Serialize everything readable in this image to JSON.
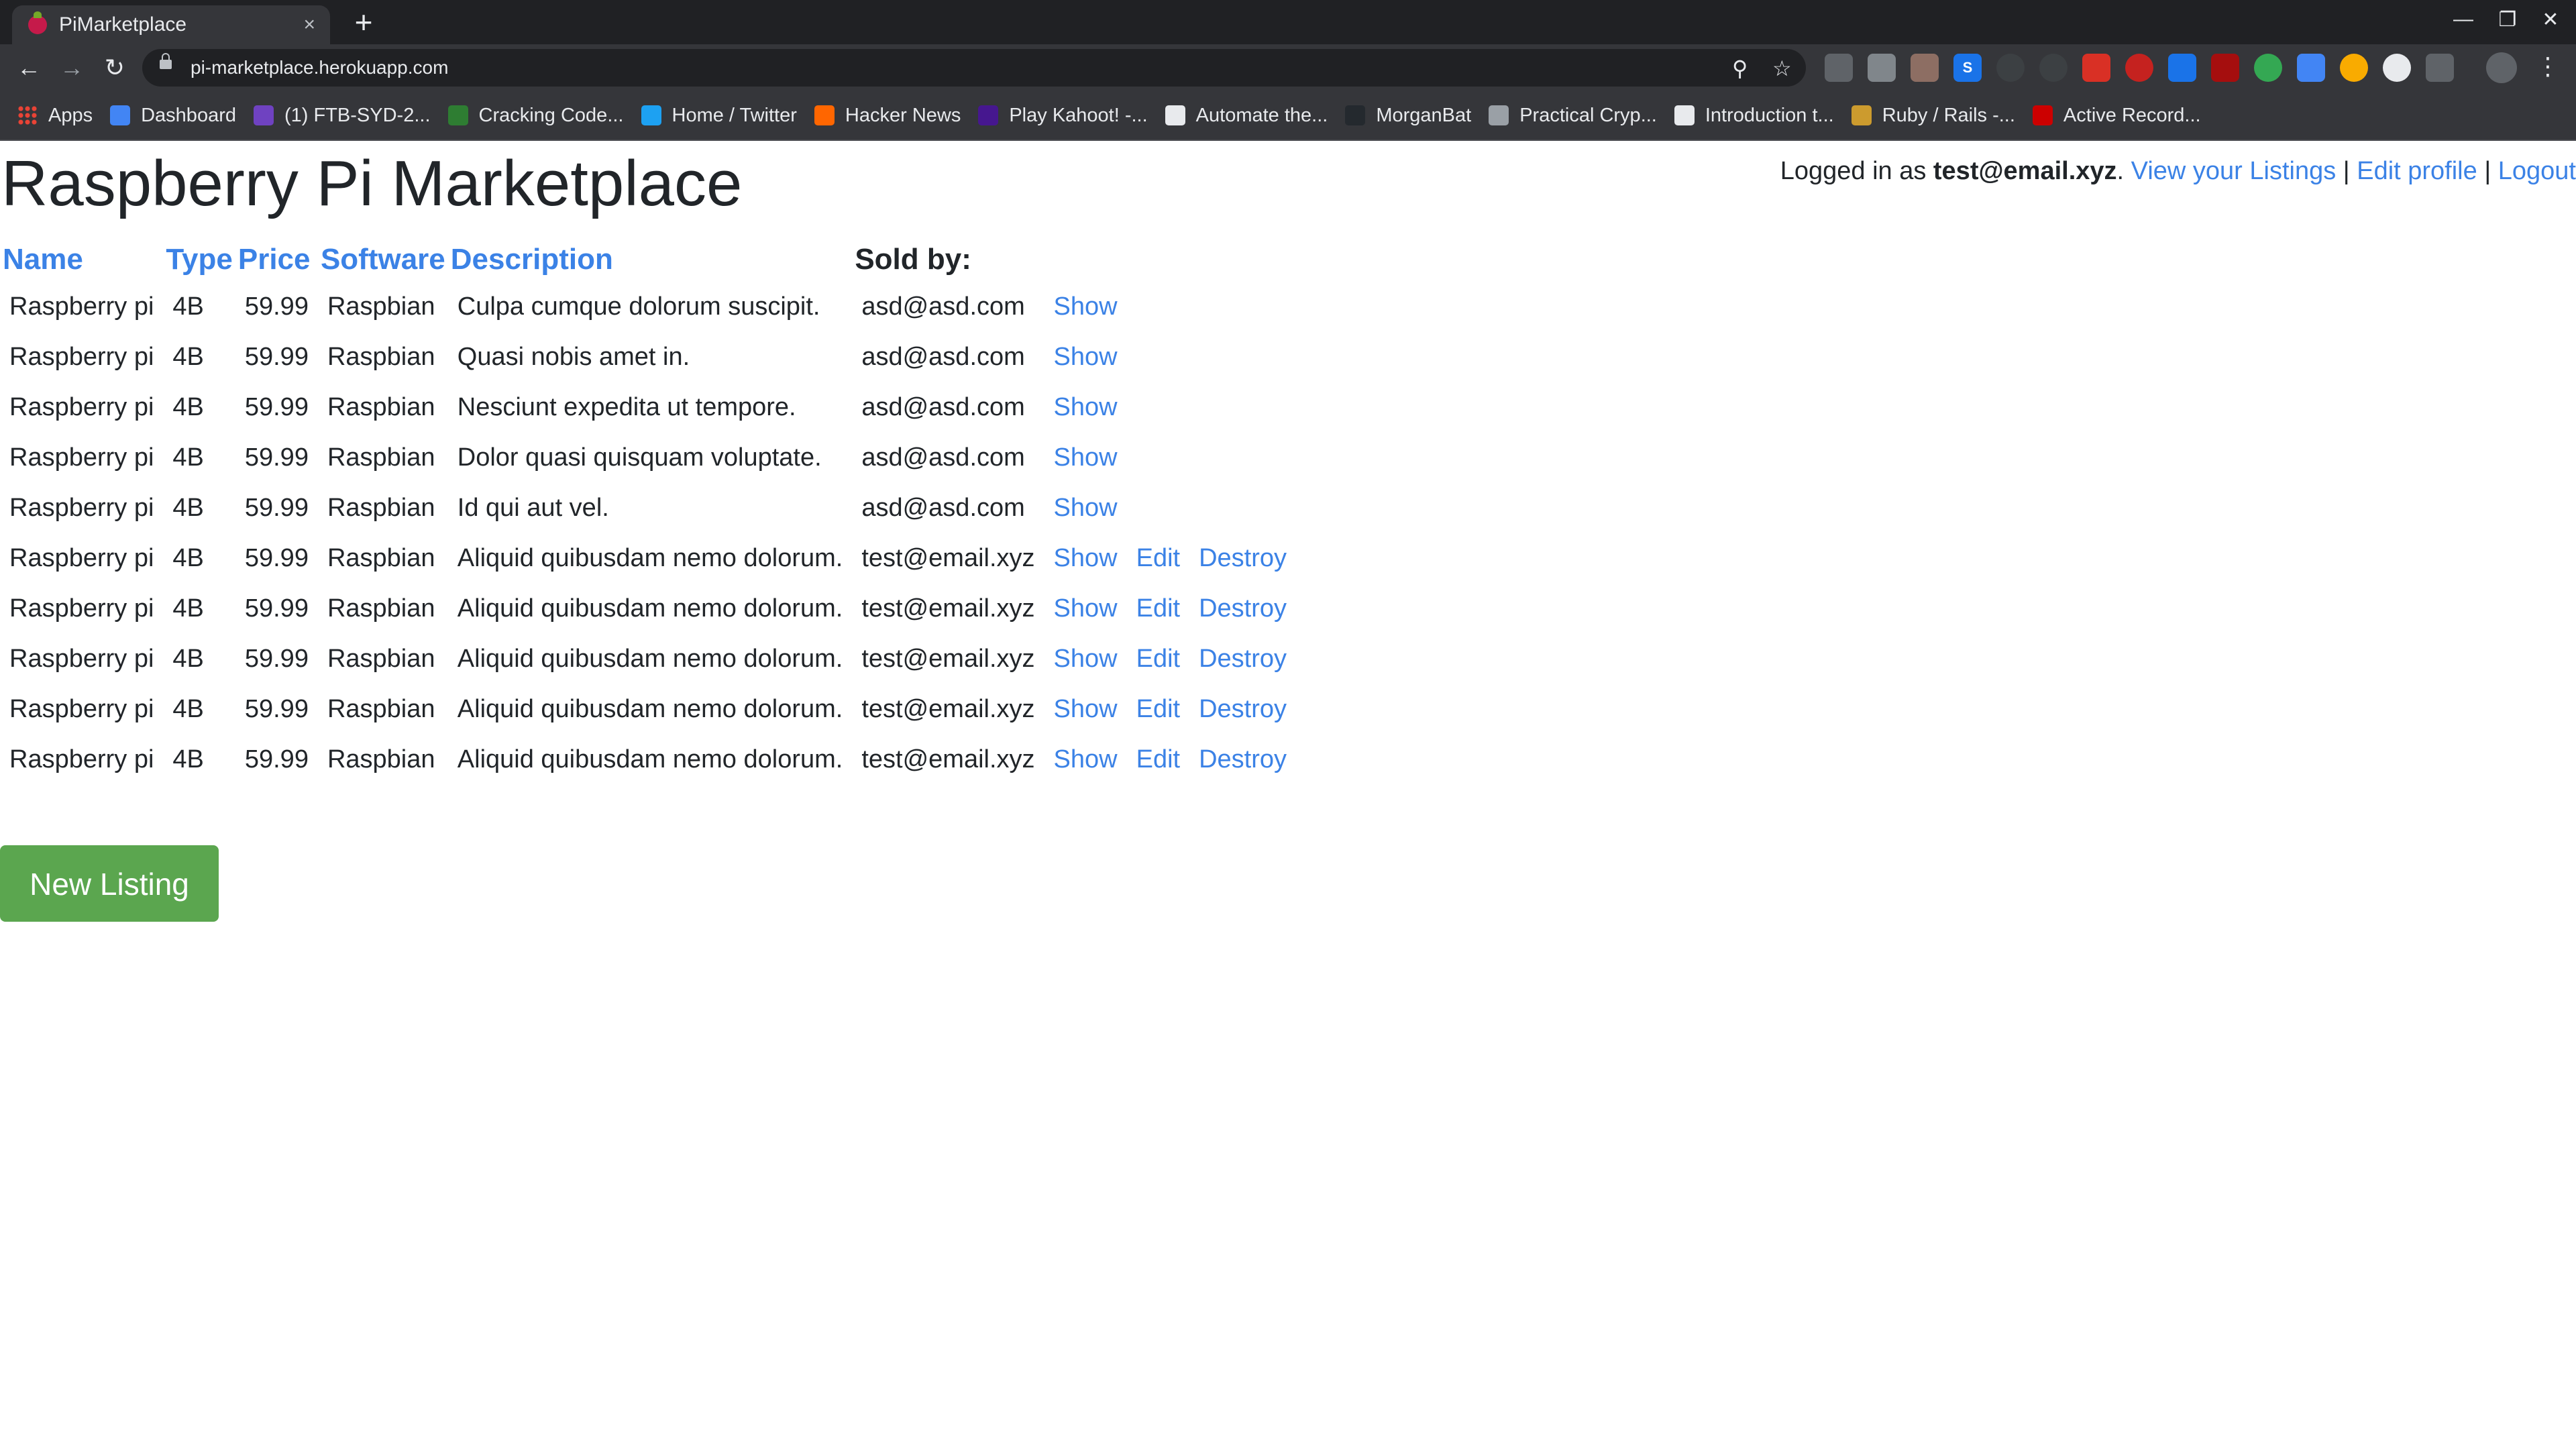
{
  "browser": {
    "tab_title": "PiMarketplace",
    "tab_close": "×",
    "new_tab": "+",
    "url": "pi-marketplace.herokuapp.com",
    "bookmarks": [
      {
        "label": "Apps",
        "icon": "apps-grid-icon",
        "color": "#ea4335"
      },
      {
        "label": "Dashboard",
        "icon": "dashboard-icon",
        "color": "#4285f4"
      },
      {
        "label": "(1) FTB-SYD-2...",
        "icon": "ed-icon",
        "color": "#6f42c1"
      },
      {
        "label": "Cracking Code...",
        "icon": "cracking-code-icon",
        "color": "#2e7d32"
      },
      {
        "label": "Home / Twitter",
        "icon": "twitter-icon",
        "color": "#1da1f2"
      },
      {
        "label": "Hacker News",
        "icon": "hacker-news-icon",
        "color": "#ff6600"
      },
      {
        "label": "Play Kahoot! -...",
        "icon": "kahoot-icon",
        "color": "#46178f"
      },
      {
        "label": "Automate the...",
        "icon": "automate-icon",
        "color": "#e8eaed"
      },
      {
        "label": "MorganBat",
        "icon": "github-icon",
        "color": "#24292e"
      },
      {
        "label": "Practical Cryp...",
        "icon": "crypto-icon",
        "color": "#9aa0a6"
      },
      {
        "label": "Introduction t...",
        "icon": "intro-icon",
        "color": "#e8eaed"
      },
      {
        "label": "Ruby / Rails -...",
        "icon": "ruby-icon",
        "color": "#cc9b2e"
      },
      {
        "label": "Active Record...",
        "icon": "active-record-icon",
        "color": "#cc0000"
      }
    ]
  },
  "header": {
    "title": "Raspberry Pi Marketplace",
    "logged_in_prefix": "Logged in as ",
    "user_email": "test@email.xyz",
    "logged_in_suffix": ".",
    "view_listings": "View your Listings",
    "edit_profile": "Edit profile",
    "logout": "Logout",
    "separator": "|"
  },
  "table": {
    "columns": {
      "name": "Name",
      "type": "Type",
      "price": "Price",
      "software": "Software",
      "description": "Description",
      "sold_by": "Sold by:"
    },
    "rows": [
      {
        "name": "Raspberry pi",
        "type": "4B",
        "price": "59.99",
        "software": "Raspbian",
        "description": "Culpa cumque dolorum suscipit.",
        "seller": "asd@asd.com",
        "show": "Show",
        "edit": "",
        "destroy": ""
      },
      {
        "name": "Raspberry pi",
        "type": "4B",
        "price": "59.99",
        "software": "Raspbian",
        "description": "Quasi nobis amet in.",
        "seller": "asd@asd.com",
        "show": "Show",
        "edit": "",
        "destroy": ""
      },
      {
        "name": "Raspberry pi",
        "type": "4B",
        "price": "59.99",
        "software": "Raspbian",
        "description": "Nesciunt expedita ut tempore.",
        "seller": "asd@asd.com",
        "show": "Show",
        "edit": "",
        "destroy": ""
      },
      {
        "name": "Raspberry pi",
        "type": "4B",
        "price": "59.99",
        "software": "Raspbian",
        "description": "Dolor quasi quisquam voluptate.",
        "seller": "asd@asd.com",
        "show": "Show",
        "edit": "",
        "destroy": ""
      },
      {
        "name": "Raspberry pi",
        "type": "4B",
        "price": "59.99",
        "software": "Raspbian",
        "description": "Id qui aut vel.",
        "seller": "asd@asd.com",
        "show": "Show",
        "edit": "",
        "destroy": ""
      },
      {
        "name": "Raspberry pi",
        "type": "4B",
        "price": "59.99",
        "software": "Raspbian",
        "description": "Aliquid quibusdam nemo dolorum.",
        "seller": "test@email.xyz",
        "show": "Show",
        "edit": "Edit",
        "destroy": "Destroy"
      },
      {
        "name": "Raspberry pi",
        "type": "4B",
        "price": "59.99",
        "software": "Raspbian",
        "description": "Aliquid quibusdam nemo dolorum.",
        "seller": "test@email.xyz",
        "show": "Show",
        "edit": "Edit",
        "destroy": "Destroy"
      },
      {
        "name": "Raspberry pi",
        "type": "4B",
        "price": "59.99",
        "software": "Raspbian",
        "description": "Aliquid quibusdam nemo dolorum.",
        "seller": "test@email.xyz",
        "show": "Show",
        "edit": "Edit",
        "destroy": "Destroy"
      },
      {
        "name": "Raspberry pi",
        "type": "4B",
        "price": "59.99",
        "software": "Raspbian",
        "description": "Aliquid quibusdam nemo dolorum.",
        "seller": "test@email.xyz",
        "show": "Show",
        "edit": "Edit",
        "destroy": "Destroy"
      },
      {
        "name": "Raspberry pi",
        "type": "4B",
        "price": "59.99",
        "software": "Raspbian",
        "description": "Aliquid quibusdam nemo dolorum.",
        "seller": "test@email.xyz",
        "show": "Show",
        "edit": "Edit",
        "destroy": "Destroy"
      }
    ]
  },
  "actions": {
    "new_listing": "New Listing"
  },
  "colors": {
    "link": "#3b82e6",
    "button": "#5ba64f",
    "text": "#212529"
  }
}
